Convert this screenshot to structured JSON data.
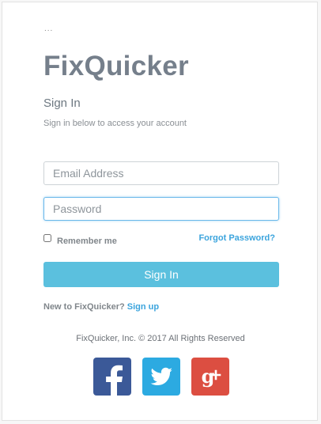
{
  "header": {
    "ellipsis": "..."
  },
  "brand": {
    "name": "FixQuicker"
  },
  "form": {
    "title": "Sign In",
    "subtitle": "Sign in below to access your account",
    "email_placeholder": "Email Address",
    "email_value": "",
    "password_placeholder": "Password",
    "password_value": "",
    "remember_label": "Remember me",
    "remember_checked": false,
    "forgot_label": "Forgot Password?",
    "submit_label": "Sign In"
  },
  "signup": {
    "prompt": "New to FixQuicker?",
    "link_label": "Sign up"
  },
  "footer": {
    "copyright": "FixQuicker, Inc. © 2017 All Rights Reserved"
  },
  "social": [
    {
      "icon": "facebook-icon",
      "color": "#3b5998"
    },
    {
      "icon": "twitter-icon",
      "color": "#2caae1"
    },
    {
      "icon": "google-plus-icon",
      "color": "#dc4e41"
    }
  ],
  "colors": {
    "brand_text": "#757f8b",
    "primary_button": "#5bc0de",
    "link": "#3ba4dd",
    "focus_border": "#69b8ea"
  }
}
